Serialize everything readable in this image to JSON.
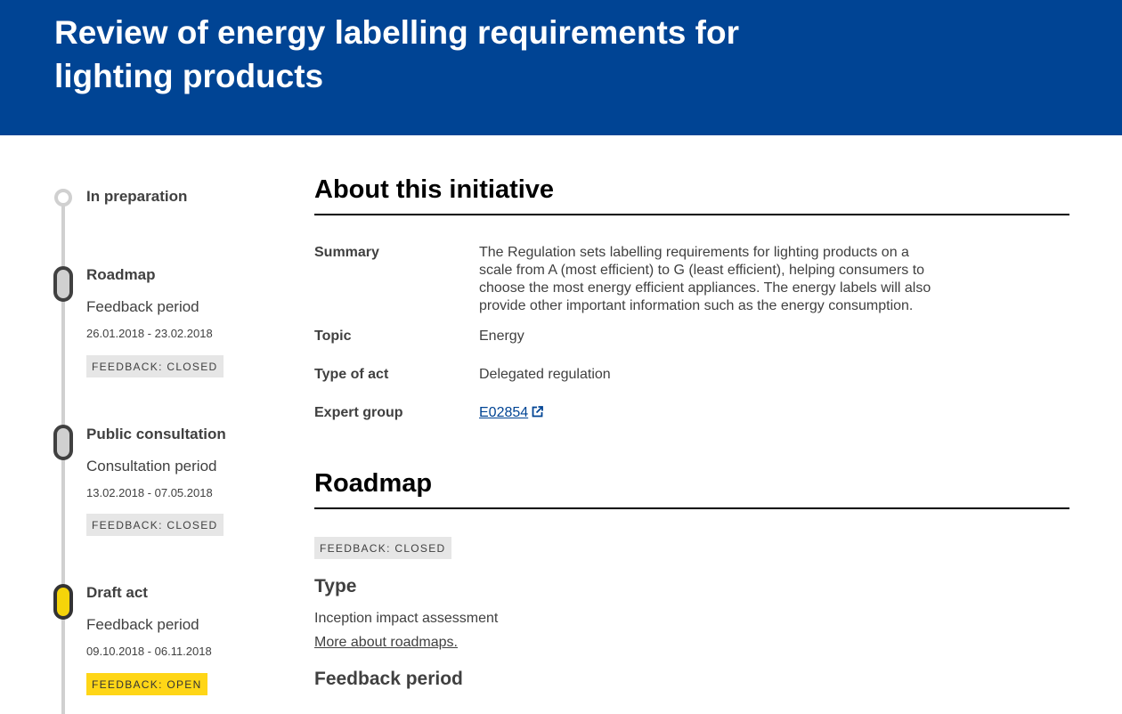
{
  "header": {
    "title": "Review of energy labelling requirements for lighting products"
  },
  "timeline": {
    "stages": [
      {
        "title": "In preparation"
      },
      {
        "title": "Roadmap",
        "period": "Feedback period",
        "dates": "26.01.2018 - 23.02.2018",
        "status": "FEEDBACK: CLOSED"
      },
      {
        "title": "Public consultation",
        "period": "Consultation period",
        "dates": "13.02.2018 - 07.05.2018",
        "status": "FEEDBACK: CLOSED"
      },
      {
        "title": "Draft act",
        "period": "Feedback period",
        "dates": "09.10.2018 - 06.11.2018",
        "status": "FEEDBACK: OPEN"
      }
    ]
  },
  "about": {
    "heading": "About this initiative",
    "summary_label": "Summary",
    "summary": "The Regulation sets labelling requirements for lighting products on a scale from A (most efficient) to G (least efficient), helping consumers to choose the most energy efficient appliances. The energy labels will also provide other important information such as the energy consumption.",
    "topic_label": "Topic",
    "topic": "Energy",
    "act_label": "Type of act",
    "act": "Delegated regulation",
    "expert_label": "Expert group",
    "expert": "E02854",
    "expert_icon": "external-link-icon"
  },
  "roadmap": {
    "heading": "Roadmap",
    "status": "FEEDBACK: CLOSED",
    "type_heading": "Type",
    "type": "Inception impact assessment",
    "more_link": "More about roadmaps.",
    "feedback_heading": "Feedback period"
  },
  "colors": {
    "brand": "#004494",
    "open_badge": "#ffd617",
    "closed_badge": "#e6e6e6"
  }
}
